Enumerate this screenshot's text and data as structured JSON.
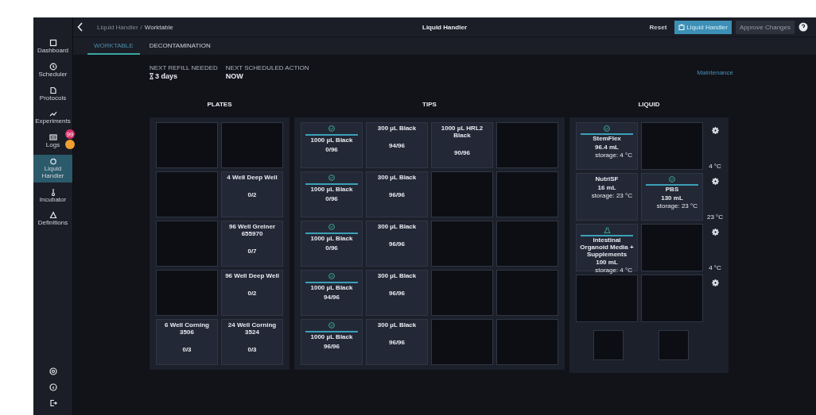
{
  "breadcrumb": {
    "parent": "Liquid Handler",
    "separator": "/",
    "current": "Worktable"
  },
  "window": {
    "title": "Liquid Handler"
  },
  "actions": [
    {
      "label": "Reset",
      "kind": "text",
      "disabled": false
    },
    {
      "label": "Liquid Handler",
      "kind": "primary",
      "disabled": false
    },
    {
      "label": "Approve Changes",
      "kind": "secondary",
      "disabled": true
    }
  ],
  "sidebar": {
    "items": [
      {
        "label": "Dashboard",
        "selected": false
      },
      {
        "label": "Scheduler",
        "selected": false
      },
      {
        "label": "Protocols",
        "selected": false
      },
      {
        "label": "Experiments",
        "selected": false
      },
      {
        "label": "Logs",
        "selected": false,
        "badges": [
          {
            "text": "99",
            "color": "#d6336c"
          },
          {
            "color": "#f0a030"
          }
        ]
      },
      {
        "label": "Liquid Handler",
        "selected": true
      },
      {
        "label": "Incubator",
        "selected": false
      },
      {
        "label": "Definitions",
        "selected": false
      }
    ]
  },
  "tabs": [
    {
      "label": "WORKTABLE",
      "selected": true
    },
    {
      "label": "DECONTAMINATION",
      "selected": false
    }
  ],
  "info": [
    {
      "label": "NEXT REFILL NEEDED",
      "value": "3 days",
      "kind": "timer"
    },
    {
      "label": "NEXT SCHEDULED ACTION",
      "value": "NOW",
      "kind": "plain"
    }
  ],
  "maintenance_link": "Maintenance",
  "plates": {
    "title": "PLATES",
    "cells": [
      {
        "kind": "empty"
      },
      {
        "kind": "empty"
      },
      {
        "kind": "empty"
      },
      {
        "kind": "plate",
        "name": "4 Well Deep Well",
        "count": "0/2"
      },
      {
        "kind": "empty"
      },
      {
        "kind": "plate",
        "name": "96 Well Greiner 655970",
        "count": "0/7"
      },
      {
        "kind": "empty"
      },
      {
        "kind": "plate",
        "name": "96 Well Deep Well",
        "count": "0/2"
      },
      {
        "kind": "plate",
        "name": "6 Well Corning 3506",
        "count": "0/3"
      },
      {
        "kind": "plate",
        "name": "24 Well Corning 3524",
        "count": "0/3"
      }
    ]
  },
  "tips": {
    "title": "TIPS",
    "cells": [
      {
        "kind": "tip",
        "verified": true,
        "name": "1000 µL Black",
        "count": "0/96"
      },
      {
        "kind": "tip",
        "verified": false,
        "name": "300 µL Black",
        "count": "94/96"
      },
      {
        "kind": "tip",
        "verified": false,
        "name": "1000 µL HRL2 Black",
        "count": "90/96"
      },
      {
        "kind": "empty"
      },
      {
        "kind": "tip",
        "verified": true,
        "name": "1000 µL Black",
        "count": "0/96"
      },
      {
        "kind": "tip",
        "verified": false,
        "name": "300 µL Black",
        "count": "96/96"
      },
      {
        "kind": "empty"
      },
      {
        "kind": "empty"
      },
      {
        "kind": "tip",
        "verified": true,
        "name": "1000 µL Black",
        "count": "0/96"
      },
      {
        "kind": "tip",
        "verified": false,
        "name": "300 µL Black",
        "count": "96/96"
      },
      {
        "kind": "empty"
      },
      {
        "kind": "empty"
      },
      {
        "kind": "tip",
        "verified": true,
        "name": "1000 µL Black",
        "count": "94/96"
      },
      {
        "kind": "tip",
        "verified": false,
        "name": "300 µL Black",
        "count": "96/96"
      },
      {
        "kind": "empty"
      },
      {
        "kind": "empty"
      },
      {
        "kind": "tip",
        "verified": true,
        "name": "1000 µL Black",
        "count": "96/96"
      },
      {
        "kind": "tip",
        "verified": false,
        "name": "300 µL Black",
        "count": "96/96"
      },
      {
        "kind": "empty"
      },
      {
        "kind": "empty"
      }
    ]
  },
  "liquid": {
    "title": "LIQUID",
    "rows": [
      {
        "temperature": "4 °C",
        "cells": [
          {
            "kind": "reagent",
            "verified": true,
            "preparing": false,
            "name": "StemFlex",
            "volume": "96.4 mL",
            "storage": "storage: 4 °C"
          },
          {
            "kind": "empty"
          }
        ]
      },
      {
        "temperature": "23 °C",
        "cells": [
          {
            "kind": "reagent",
            "verified": false,
            "preparing": false,
            "name": "NutriSF",
            "volume": "16 mL",
            "storage": "storage: 23 °C"
          },
          {
            "kind": "reagent",
            "verified": true,
            "preparing": false,
            "name": "PBS",
            "volume": "130 mL",
            "storage": "storage: 23 °C"
          }
        ]
      },
      {
        "temperature": "4 °C",
        "cells": [
          {
            "kind": "reagent",
            "verified": false,
            "preparing": true,
            "name": "Intestinal Organoid Media + Supplements",
            "volume": "100 mL",
            "storage": "storage: 4 °C"
          },
          {
            "kind": "empty"
          }
        ]
      },
      {
        "cells": [
          {
            "kind": "empty"
          },
          {
            "kind": "empty"
          }
        ]
      }
    ],
    "bottom": [
      {
        "kind": "empty"
      },
      {
        "kind": "empty"
      }
    ]
  }
}
